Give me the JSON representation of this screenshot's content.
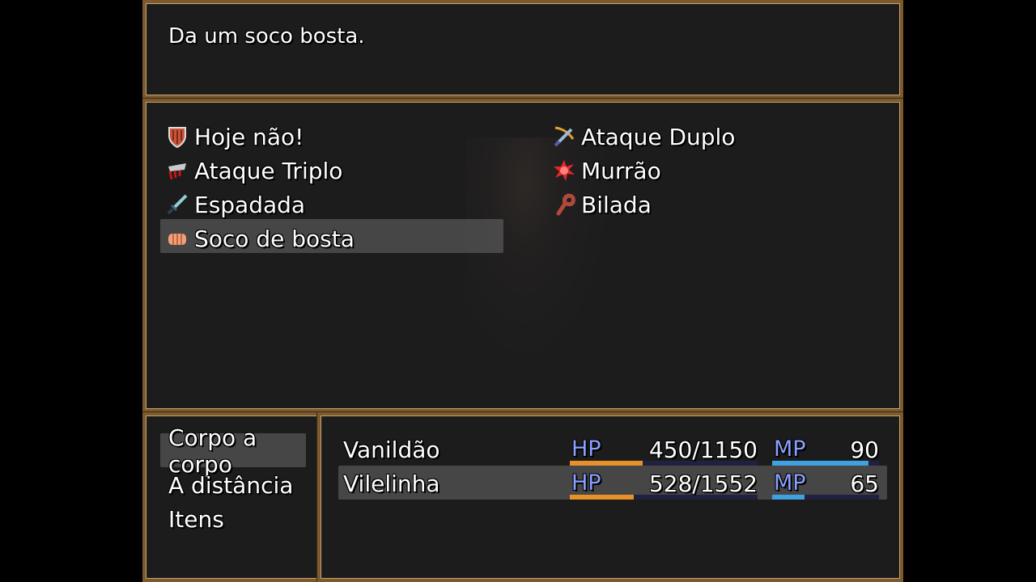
{
  "help": {
    "text": "Da um soco bosta."
  },
  "skills": [
    {
      "name": "Hoje não!",
      "icon": "shield-icon"
    },
    {
      "name": "Ataque Duplo",
      "icon": "sword-bow-icon"
    },
    {
      "name": "Ataque Triplo",
      "icon": "bloody-blade-icon"
    },
    {
      "name": "Murrão",
      "icon": "burst-icon"
    },
    {
      "name": "Espadada",
      "icon": "sword-icon"
    },
    {
      "name": "Bilada",
      "icon": "club-icon"
    },
    {
      "name": "Soco de bosta",
      "icon": "fist-icon",
      "selected": true
    }
  ],
  "commands": [
    {
      "label": "Corpo a corpo",
      "selected": true
    },
    {
      "label": "A distância"
    },
    {
      "label": "Itens"
    }
  ],
  "party": [
    {
      "name": "Vanildão",
      "hp_label": "HP",
      "hp": "450/1150",
      "hp_ratio": 0.39,
      "mp_label": "MP",
      "mp": "90",
      "mp_ratio": 0.9
    },
    {
      "name": "Vilelinha",
      "hp_label": "HP",
      "hp": "528/1552",
      "hp_ratio": 0.34,
      "mp_label": "MP",
      "mp": "65",
      "mp_ratio": 0.3,
      "selected": true
    }
  ],
  "colors": {
    "frame": "#7a5a2e",
    "hp_gauge": "#e8902a",
    "mp_gauge": "#40a0e0",
    "system_label": "#8aa0ff"
  }
}
